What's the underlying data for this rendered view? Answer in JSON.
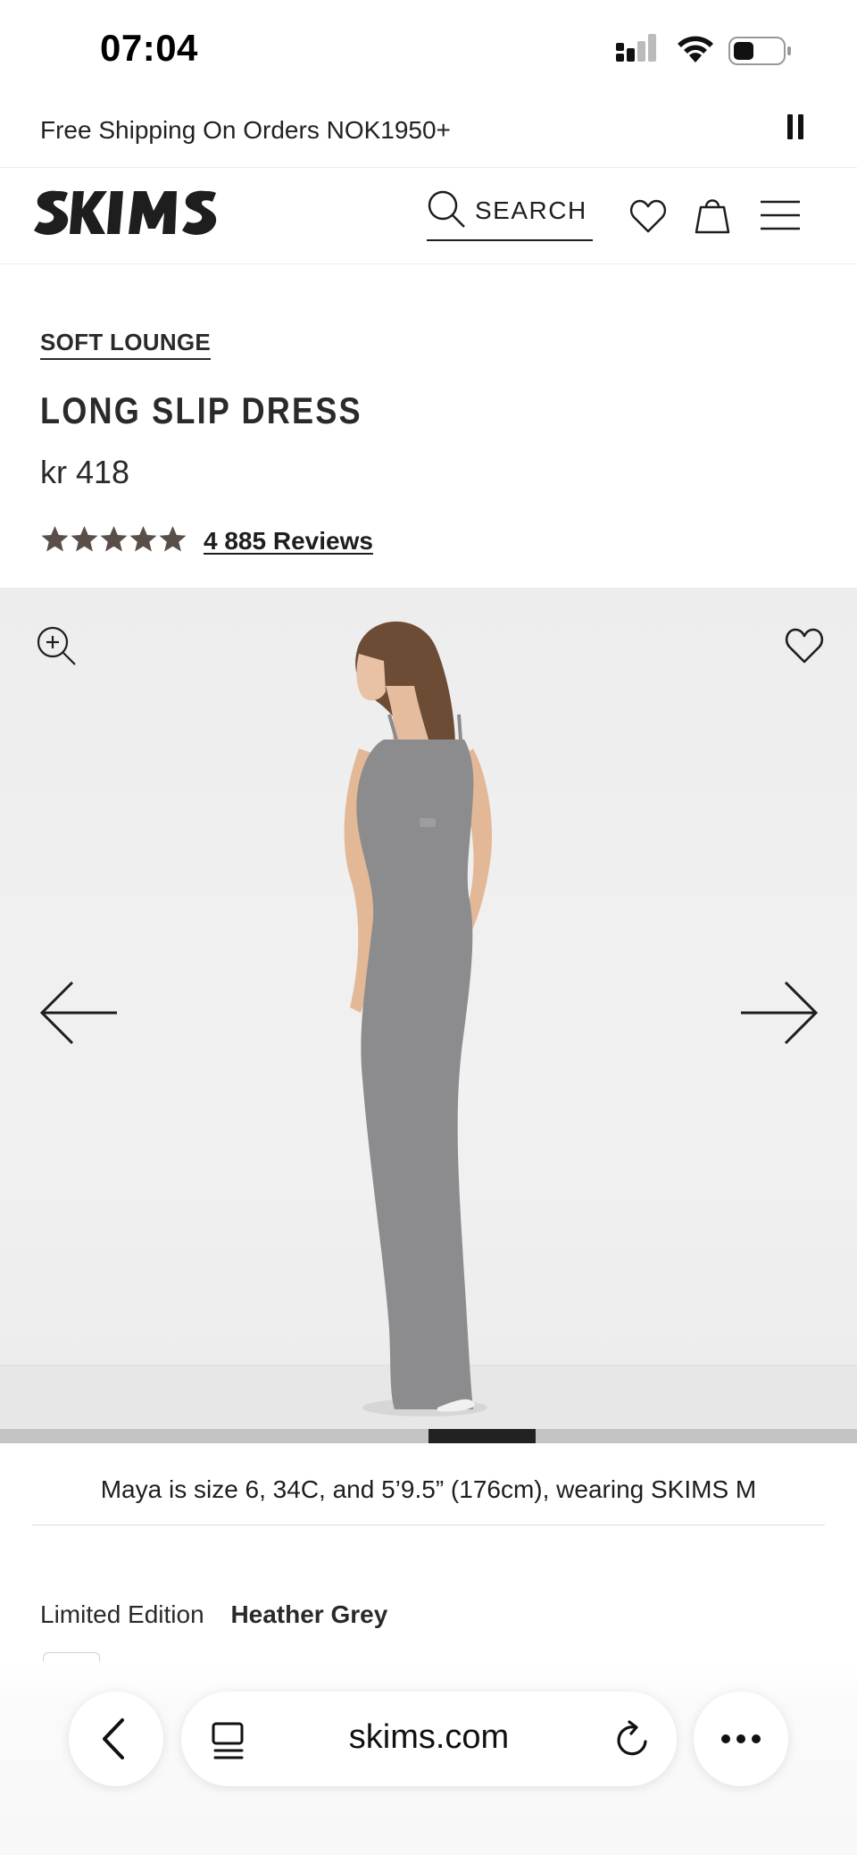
{
  "status_bar": {
    "time": "07:04"
  },
  "announcement": {
    "text": "Free Shipping On Orders NOK1950+"
  },
  "header": {
    "search_label": "SEARCH"
  },
  "product": {
    "collection": "SOFT LOUNGE",
    "title": "LONG SLIP DRESS",
    "price": "kr 418",
    "rating": 5,
    "reviews_label": "4 885 Reviews"
  },
  "gallery": {
    "progress_start": 0.5,
    "progress_end": 0.625,
    "caption": "Maya is size 6, 34C, and 5’9.5” (176cm), wearing SKIMS M"
  },
  "color": {
    "label": "Limited Edition",
    "value": "Heather Grey"
  },
  "browser": {
    "url": "skims.com"
  },
  "colors": {
    "dress": "#8c8c8e",
    "star": "#5a4f48",
    "text": "#1e1e1e"
  },
  "icons": [
    "search-icon",
    "heart-icon",
    "bag-icon",
    "menu-icon",
    "zoom-in-icon",
    "arrow-left-icon",
    "arrow-right-icon",
    "chevron-left-icon",
    "tabs-icon",
    "reload-icon",
    "more-icon",
    "pause-icon"
  ]
}
